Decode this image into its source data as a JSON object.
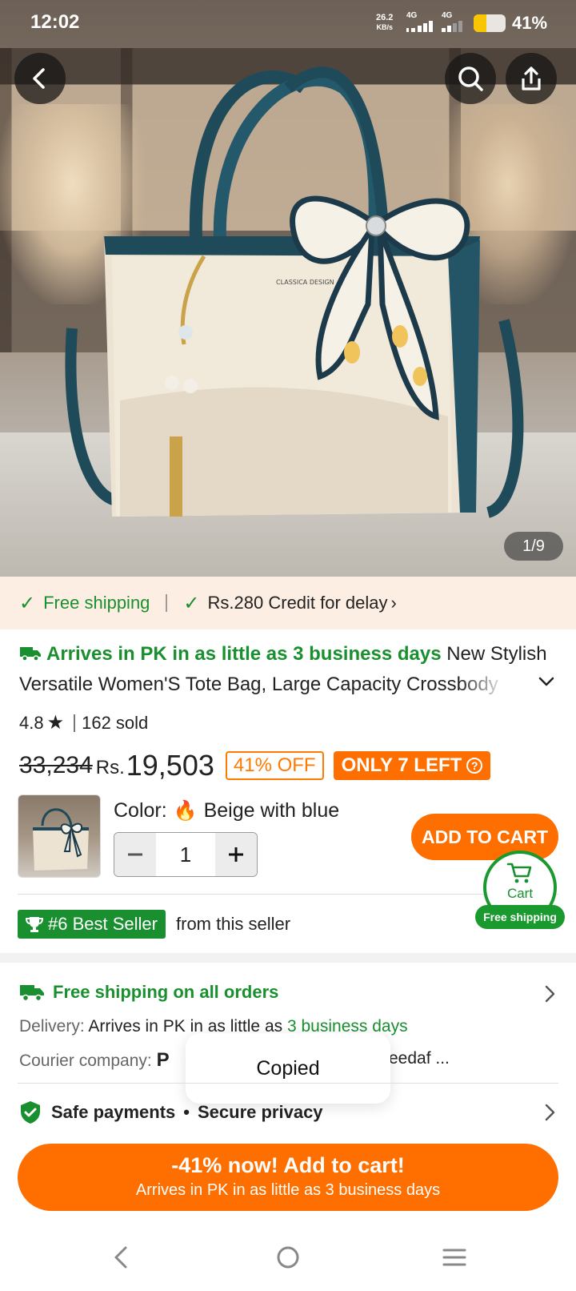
{
  "status_bar": {
    "time": "12:02",
    "net_speed_value": "26.2",
    "net_speed_unit": "KB/s",
    "sim1": "4G",
    "sim2": "4G",
    "battery_percent": "41%",
    "battery_level": 0.41
  },
  "hero": {
    "image_counter": "1/9",
    "logo_text": "CLASSICA DESIGN"
  },
  "shipping_banner": {
    "free_shipping": "Free shipping",
    "credit": "Rs.280 Credit for delay"
  },
  "product": {
    "arrival": "Arrives in PK in as little as 3 business days",
    "title_part1": "New Stylish",
    "title_part2": "Versatile Women'S Tote Bag, Large Capacity Crossbody",
    "rating": "4.8",
    "sold": "162 sold",
    "old_price": "33,234",
    "currency": "Rs.",
    "price": "19,503",
    "discount": "41% OFF",
    "stock": "ONLY 7 LEFT",
    "color_label": "Color:",
    "color_value": "Beige with blue",
    "quantity": "1",
    "add_to_cart": "ADD TO CART"
  },
  "cart_widget": {
    "label": "Cart",
    "badge": "Free shipping"
  },
  "best_seller": {
    "badge": "#6 Best Seller",
    "note": "from this seller"
  },
  "delivery": {
    "free_all": "Free shipping on all orders",
    "delivery_key": "Delivery:",
    "delivery_value": "Arrives in PK in as little as",
    "delivery_days": "3 business days",
    "courier_key": "Courier company:",
    "courier_value": "P",
    "courier_tail": "eedaf ..."
  },
  "toast": {
    "message": "Copied"
  },
  "safe": {
    "payments": "Safe payments",
    "privacy": "Secure privacy"
  },
  "cta": {
    "line1": "-41% now! Add to cart!",
    "line2": "Arrives in PK in as little as 3 business days"
  },
  "colors": {
    "accent_orange": "#ff6f00",
    "green": "#1a8f2f",
    "banner_bg": "#fdeee3"
  }
}
